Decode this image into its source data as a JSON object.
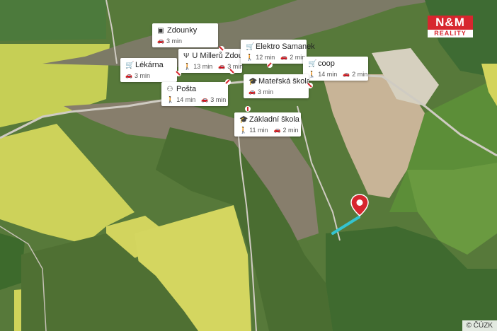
{
  "map": {
    "colors": {
      "field_yellow": "#d9da5e",
      "field_green": "#5f8a3a",
      "forest": "#3d5a2a",
      "village": "#8a7f70",
      "brown_field": "#c7b299",
      "road": "#c9c6c0",
      "route": "#34c3d0",
      "pin": "#d7262e"
    }
  },
  "brand": {
    "line1": "N&M",
    "line2": "REALITY"
  },
  "attribution": "© ČÚZK",
  "pois": [
    {
      "id": "zdounky",
      "icon": "bus-icon",
      "glyph": "▣",
      "name": "Zdounky",
      "car": "3 min"
    },
    {
      "id": "u-milleru",
      "icon": "restaurant-icon",
      "glyph": "Ψ",
      "name": "U Millerů Zdounky",
      "walk": "13 min",
      "car": "3 min"
    },
    {
      "id": "elektro",
      "icon": "shop-cart-icon",
      "glyph": "🛒",
      "name": "Elektro Samanek",
      "walk": "12 min",
      "car": "2 min"
    },
    {
      "id": "lekarna",
      "icon": "shop-cart-icon",
      "glyph": "🛒",
      "name": "Lékárna",
      "car": "3 min"
    },
    {
      "id": "coop",
      "icon": "shop-cart-icon",
      "glyph": "🛒",
      "name": "coop",
      "walk": "14 min",
      "car": "2 min"
    },
    {
      "id": "materska",
      "icon": "school-icon",
      "glyph": "🎓",
      "name": "Mateřská škola Z...",
      "car": "3 min"
    },
    {
      "id": "posta",
      "icon": "post-icon",
      "glyph": "⚇",
      "name": "Pošta",
      "walk": "14 min",
      "car": "3 min"
    },
    {
      "id": "zakladni",
      "icon": "school-icon",
      "glyph": "🎓",
      "name": "Základní škola Zd...",
      "walk": "11 min",
      "car": "2 min"
    }
  ]
}
